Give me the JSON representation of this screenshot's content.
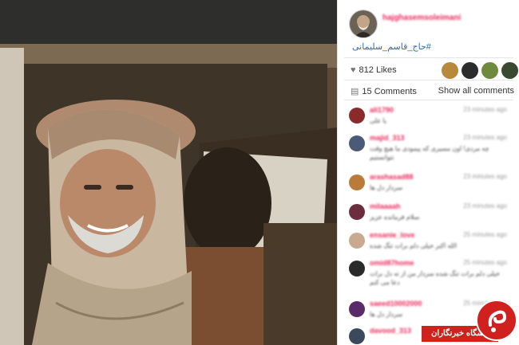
{
  "post": {
    "username": "hajghasemsoleimani",
    "hashtag": "#حاج_قاسم_سلیمانی",
    "likes_label": "812 Likes",
    "comments_label": "15 Comments",
    "show_all_label": "Show all comments"
  },
  "comments": [
    {
      "user": "ali1790",
      "time": "23 minutes ago",
      "text": "یا علی"
    },
    {
      "user": "majid_313",
      "time": "23 minutes ago",
      "text": "چه مردی! اون مسیری که پیمودی ما هیچ وقت نتوانستیم"
    },
    {
      "user": "arashasad88",
      "time": "23 minutes ago",
      "text": "سردار دل ها"
    },
    {
      "user": "milaaaah",
      "time": "23 minutes ago",
      "text": "سلام فرمانده عزیز"
    },
    {
      "user": "ensanie_love",
      "time": "25 minutes ago",
      "text": "الله اکبر خیلی دلم برات تنگ شده"
    },
    {
      "user": "omid87home",
      "time": "25 minutes ago",
      "text": "خیلی دلم برات تنگ شده سردار من از ته دل برات دعا می کنم"
    },
    {
      "user": "saeed10002000",
      "time": "25 minutes ago",
      "text": "سردار دل ها"
    },
    {
      "user": "davood_313",
      "time": "",
      "text": ""
    }
  ],
  "badge": {
    "label": "باشگاه خبرنگاران"
  },
  "colors": {
    "username": "#e8265a",
    "hashtag": "#2a6eb8",
    "badge": "#d1211f"
  }
}
